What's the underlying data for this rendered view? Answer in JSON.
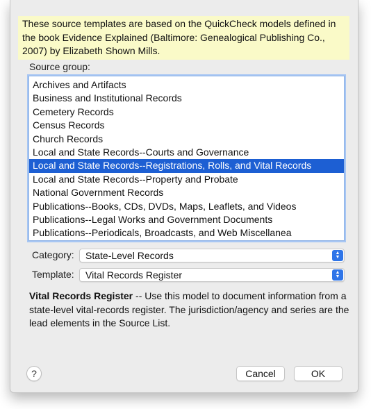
{
  "notice": "These source templates are based on the QuickCheck models defined in the book Evidence Explained (Baltimore: Genealogical Publishing Co., 2007) by Elizabeth Shown Mills.",
  "source_group": {
    "label": "Source group:",
    "items": [
      "Archives and Artifacts",
      "Business and Institutional Records",
      "Cemetery Records",
      "Census Records",
      "Church Records",
      "Local and State Records--Courts and Governance",
      "Local and State Records--Registrations, Rolls, and Vital Records",
      "Local and State Records--Property and Probate",
      "National Government Records",
      "Publications--Books, CDs, DVDs, Maps, Leaflets, and Videos",
      "Publications--Legal Works and Government Documents",
      "Publications--Periodicals, Broadcasts, and Web Miscellanea"
    ],
    "selected_index": 6
  },
  "category": {
    "label": "Category:",
    "value": "State-Level Records"
  },
  "template": {
    "label": "Template:",
    "value": "Vital Records Register"
  },
  "description": {
    "title": "Vital Records Register",
    "text": " -- Use this model to document information from a state-level vital-records register.  The jurisdiction/agency and series are the lead elements in the Source List."
  },
  "buttons": {
    "help": "?",
    "cancel": "Cancel",
    "ok": "OK"
  },
  "colors": {
    "selection": "#1d5fd3",
    "notice_bg": "#fafac8",
    "stepper": "#2f75e8"
  }
}
